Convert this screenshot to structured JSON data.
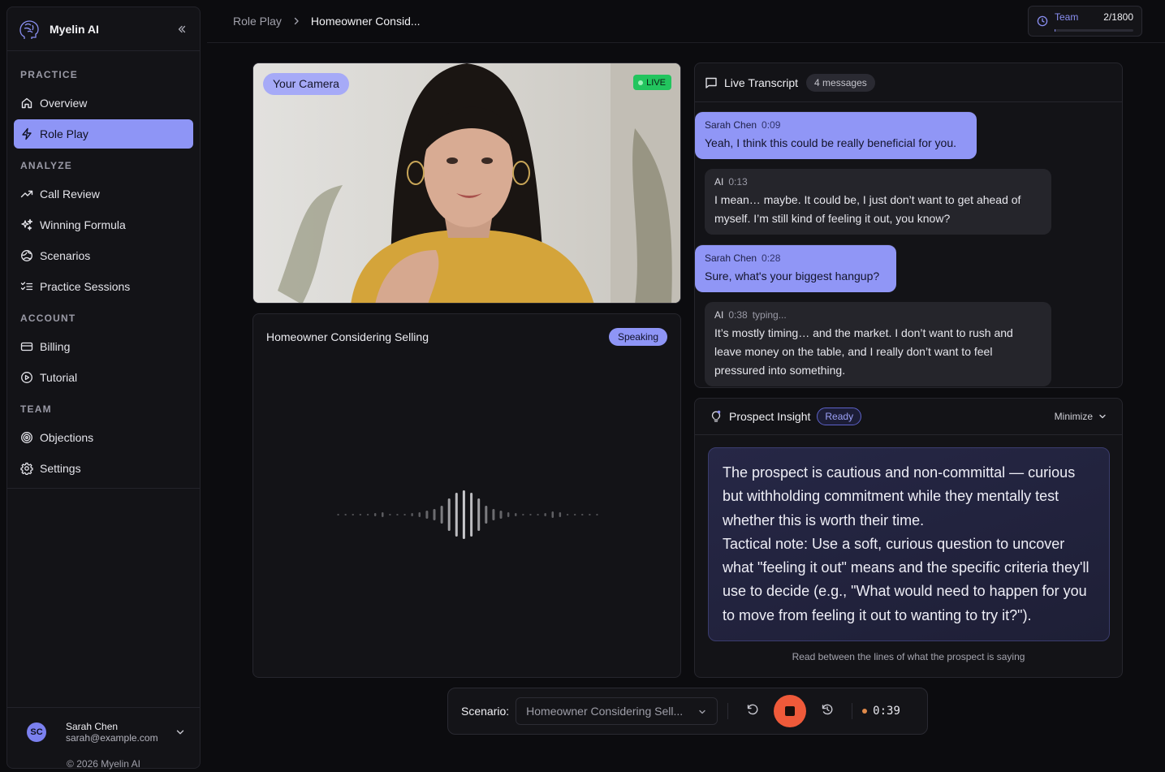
{
  "brand": {
    "name": "Myelin AI"
  },
  "sidebar": {
    "sections": [
      {
        "label": "PRACTICE",
        "items": [
          {
            "label": "Overview",
            "icon": "home-icon",
            "active": false
          },
          {
            "label": "Role Play",
            "icon": "zap-icon",
            "active": true
          }
        ]
      },
      {
        "label": "ANALYZE",
        "items": [
          {
            "label": "Call Review",
            "icon": "trending-up-icon"
          },
          {
            "label": "Winning Formula",
            "icon": "sparkles-icon"
          },
          {
            "label": "Scenarios",
            "icon": "globe-icon"
          },
          {
            "label": "Practice Sessions",
            "icon": "list-checks-icon"
          }
        ]
      },
      {
        "label": "ACCOUNT",
        "items": [
          {
            "label": "Billing",
            "icon": "credit-card-icon"
          },
          {
            "label": "Tutorial",
            "icon": "play-circle-icon"
          }
        ]
      },
      {
        "label": "TEAM",
        "items": [
          {
            "label": "Objections",
            "icon": "target-icon"
          },
          {
            "label": "Settings",
            "icon": "gear-icon"
          }
        ]
      }
    ]
  },
  "user": {
    "initials": "SC",
    "name": "Sarah Chen",
    "email": "sarah@example.com"
  },
  "copyright": "© 2026 Myelin AI",
  "header": {
    "breadcrumb_root": "Role Play",
    "breadcrumb_current": "Homeowner Consid...",
    "team_label": "Team",
    "team_count": "2/1800",
    "team_usage_fraction": 0.0011
  },
  "camera": {
    "label": "Your Camera",
    "live": "LIVE"
  },
  "prospect": {
    "title": "Homeowner Considering Selling",
    "status": "Speaking"
  },
  "transcript": {
    "title": "Live Transcript",
    "count": "4 messages",
    "messages": [
      {
        "role": "user",
        "name": "Sarah Chen",
        "time": "0:09",
        "status": "",
        "text": "Yeah, I think this could be really beneficial for you."
      },
      {
        "role": "ai",
        "name": "AI",
        "time": "0:13",
        "status": "",
        "text": "I mean… maybe. It could be, I just don’t want to get ahead of myself. I’m still kind of feeling it out, you know?"
      },
      {
        "role": "user",
        "name": "Sarah Chen",
        "time": "0:28",
        "status": "",
        "text": "Sure, what's your biggest hangup?"
      },
      {
        "role": "ai",
        "name": "AI",
        "time": "0:38",
        "status": "typing...",
        "text": "It’s mostly timing… and the market. I don’t want to rush and leave money on the table, and I really don’t want to feel pressured into something."
      }
    ]
  },
  "insight": {
    "title": "Prospect Insight",
    "status": "Ready",
    "minimize": "Minimize",
    "paragraph1": "The prospect is cautious and non-committal — curious but withholding commitment while they mentally test whether this is worth their time.",
    "paragraph2": "Tactical note: Use a soft, curious question to uncover what \"feeling it out\" means and the specific criteria they'll use to decide (e.g., \"What would need to happen for you to move from feeling it out to wanting to try it?\").",
    "footer": "Read between the lines of what the prospect is saying"
  },
  "controls": {
    "scenario_label": "Scenario:",
    "scenario_value": "Homeowner Considering Sell...",
    "timer": "0:39"
  },
  "colors": {
    "accent": "#8e95f6",
    "live": "#22c55e",
    "stop": "#ef5a3a"
  }
}
